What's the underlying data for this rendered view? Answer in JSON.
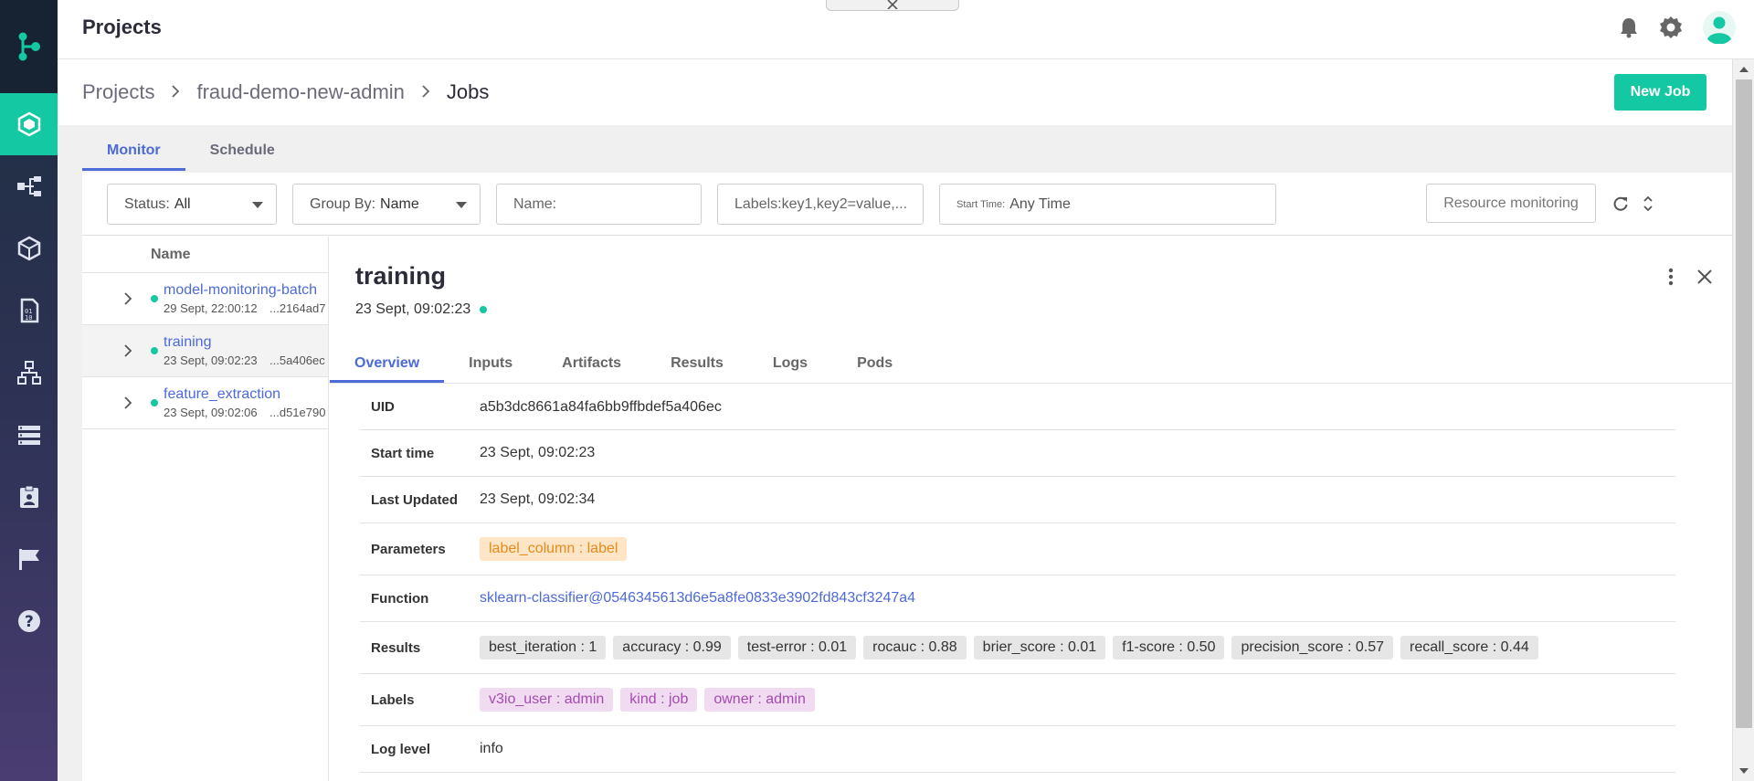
{
  "colors": {
    "accent": "#13c8a3",
    "link": "#4c6ad8",
    "sidebar": "#2f3356"
  },
  "header": {
    "title": "Projects"
  },
  "sidebar": {
    "items": [
      {
        "icon": "projects-icon",
        "active": true
      },
      {
        "icon": "pipelines-icon"
      },
      {
        "icon": "feature-store-icon"
      },
      {
        "icon": "datasets-icon"
      },
      {
        "icon": "models-icon"
      },
      {
        "icon": "jobs-list-icon"
      },
      {
        "icon": "registry-icon"
      },
      {
        "icon": "flag-icon"
      },
      {
        "icon": "help-icon"
      }
    ]
  },
  "breadcrumb": {
    "root": "Projects",
    "project": "fraud-demo-new-admin",
    "current": "Jobs"
  },
  "actions": {
    "new_job": "New Job"
  },
  "tabs": {
    "monitor": "Monitor",
    "schedule": "Schedule"
  },
  "filters": {
    "status_label": "Status:",
    "status_value": "All",
    "groupby_label": "Group By:",
    "groupby_value": "Name",
    "name_placeholder": "Name:",
    "labels_placeholder": "Labels:key1,key2=value,...",
    "start_label": "Start Time:",
    "start_value": "Any Time",
    "resource_monitoring": "Resource monitoring"
  },
  "joblist": {
    "header": "Name",
    "rows": [
      {
        "name": "model-monitoring-batch",
        "date": "29 Sept, 22:00:12",
        "uid": "...2164ad7"
      },
      {
        "name": "training",
        "date": "23 Sept, 09:02:23",
        "uid": "...5a406ec"
      },
      {
        "name": "feature_extraction",
        "date": "23 Sept, 09:02:06",
        "uid": "...d51e790"
      }
    ]
  },
  "detail": {
    "title": "training",
    "date": "23 Sept, 09:02:23",
    "tabs": [
      "Overview",
      "Inputs",
      "Artifacts",
      "Results",
      "Logs",
      "Pods"
    ],
    "fields": {
      "uid_key": "UID",
      "uid": "a5b3dc8661a84fa6bb9ffbdef5a406ec",
      "start_key": "Start time",
      "start": "23 Sept, 09:02:23",
      "updated_key": "Last Updated",
      "updated": "23 Sept, 09:02:34",
      "params_key": "Parameters",
      "params": [
        "label_column : label"
      ],
      "function_key": "Function",
      "function": "sklearn-classifier@0546345613d6e5a8fe0833e3902fd843cf3247a4",
      "results_key": "Results",
      "results": [
        "best_iteration : 1",
        "accuracy : 0.99",
        "test-error : 0.01",
        "rocauc : 0.88",
        "brier_score : 0.01",
        "f1-score : 0.50",
        "precision_score : 0.57",
        "recall_score : 0.44"
      ],
      "labels_key": "Labels",
      "labels": [
        "v3io_user : admin",
        "kind : job",
        "owner : admin"
      ],
      "loglevel_key": "Log level",
      "loglevel": "info"
    }
  }
}
